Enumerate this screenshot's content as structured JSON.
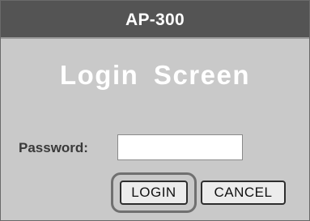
{
  "window": {
    "title": "AP-300"
  },
  "login": {
    "heading": "Login  Screen",
    "password_label": "Password:",
    "password_value": "",
    "login_button": "LOGIN",
    "cancel_button": "CANCEL"
  },
  "colors": {
    "title_bar": "#545454",
    "panel_background": "#c9c9c9",
    "heading_text": "#ffffff"
  }
}
